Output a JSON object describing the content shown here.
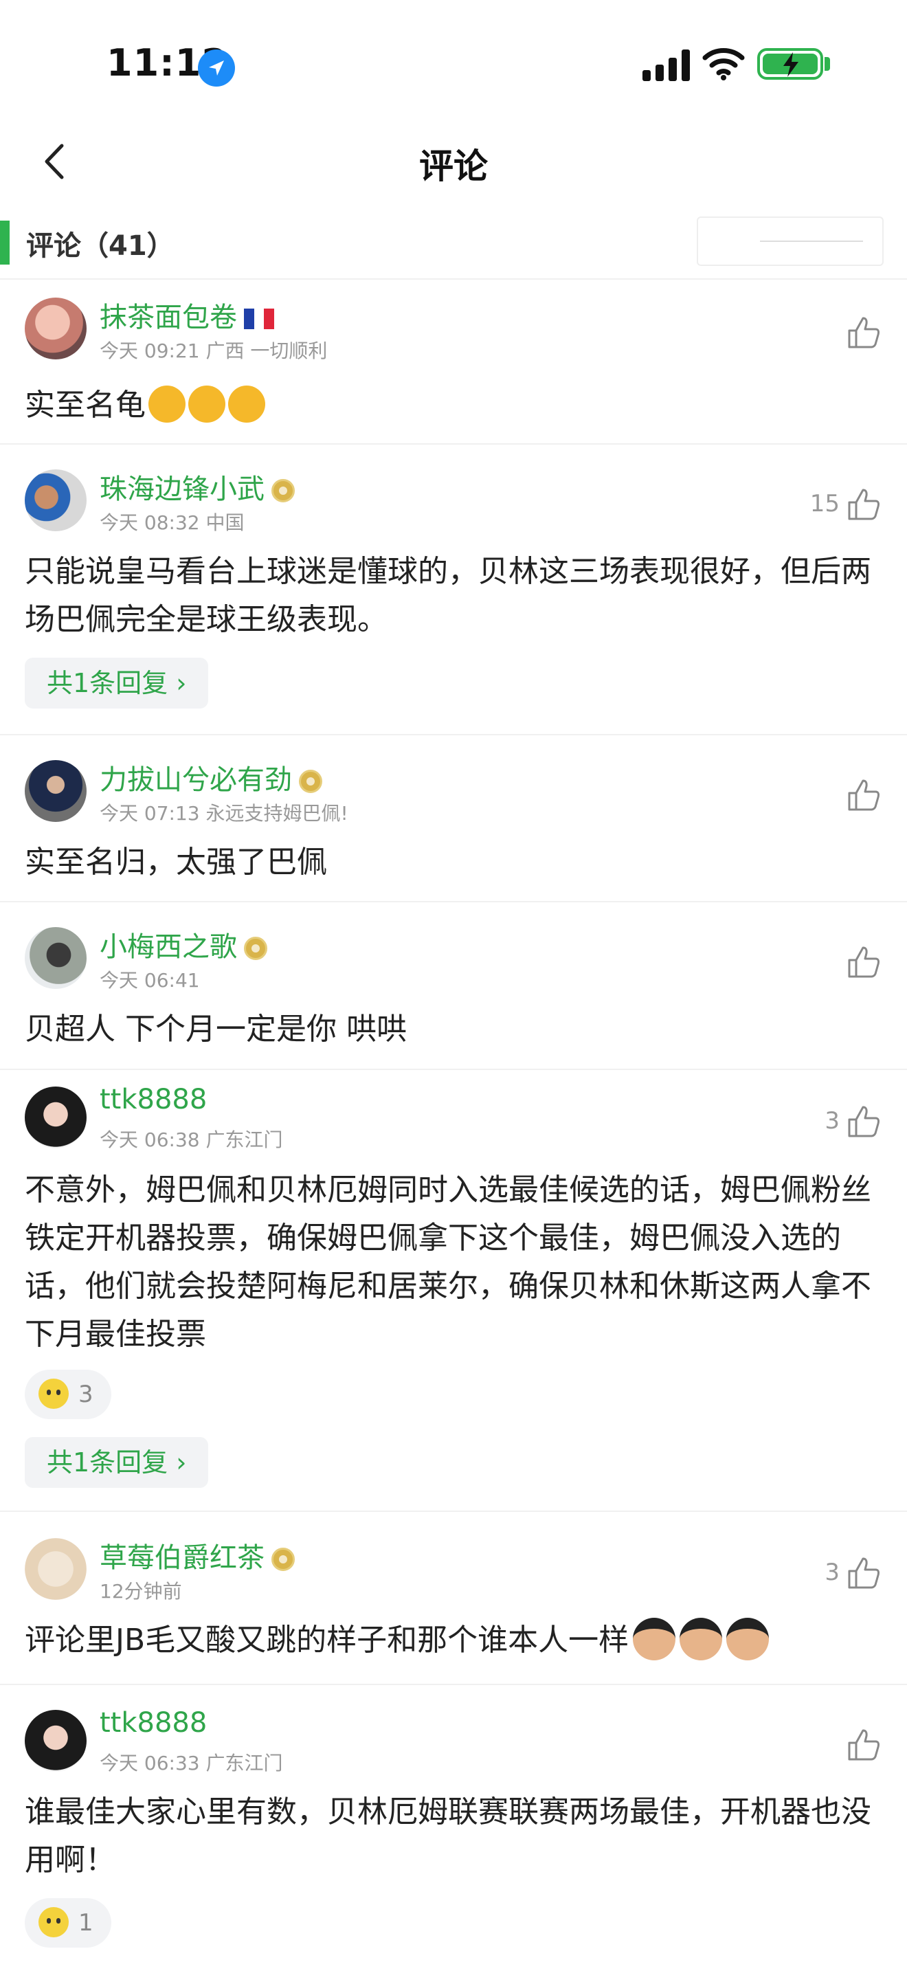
{
  "status_bar": {
    "time": "11:12"
  },
  "nav": {
    "title": "评论"
  },
  "section": {
    "label": "评论（41）"
  },
  "comments": [
    {
      "name": "抹茶面包卷",
      "meta": "今天 09:21 广西 一切顺利",
      "likes": "",
      "text": "实至名龟",
      "badge": "flag-france",
      "emoji": "thumbs-up x3"
    },
    {
      "name": "珠海边锋小武",
      "meta": "今天 08:32 中国",
      "likes": "15",
      "text": "只能说皇马看台上球迷是懂球的，贝林这三场表现很好，但后两场巴佩完全是球王级表现。",
      "reply": "共1条回复 ›"
    },
    {
      "name": "力拔山兮必有劲",
      "meta": "今天 07:13 永远支持姆巴佩!",
      "likes": "",
      "text": "实至名归，太强了巴佩"
    },
    {
      "name": "小梅西之歌",
      "meta": "今天 06:41",
      "likes": "",
      "text": "贝超人 下个月一定是你 哄哄"
    },
    {
      "name": "ttk8888",
      "meta": "今天 06:38 广东江门",
      "likes": "3",
      "text": "不意外，姆巴佩和贝林厄姆同时入选最佳候选的话，姆巴佩粉丝铁定开机器投票，确保姆巴佩拿下这个最佳，姆巴佩没入选的话，他们就会投楚阿梅尼和居莱尔，确保贝林和休斯这两人拿不下月最佳投票",
      "reaction_count": "3",
      "reply": "共1条回复 ›"
    },
    {
      "name": "草莓伯爵红茶",
      "meta": "12分钟前",
      "likes": "3",
      "text": "评论里JB毛又酸又跳的样子和那个谁本人一样"
    },
    {
      "name": "ttk8888",
      "meta": "今天 06:33 广东江门",
      "likes": "",
      "text": "谁最佳大家心里有数，贝林厄姆联赛联赛两场最佳，开机器也没用啊！",
      "reaction_count": "1"
    }
  ]
}
